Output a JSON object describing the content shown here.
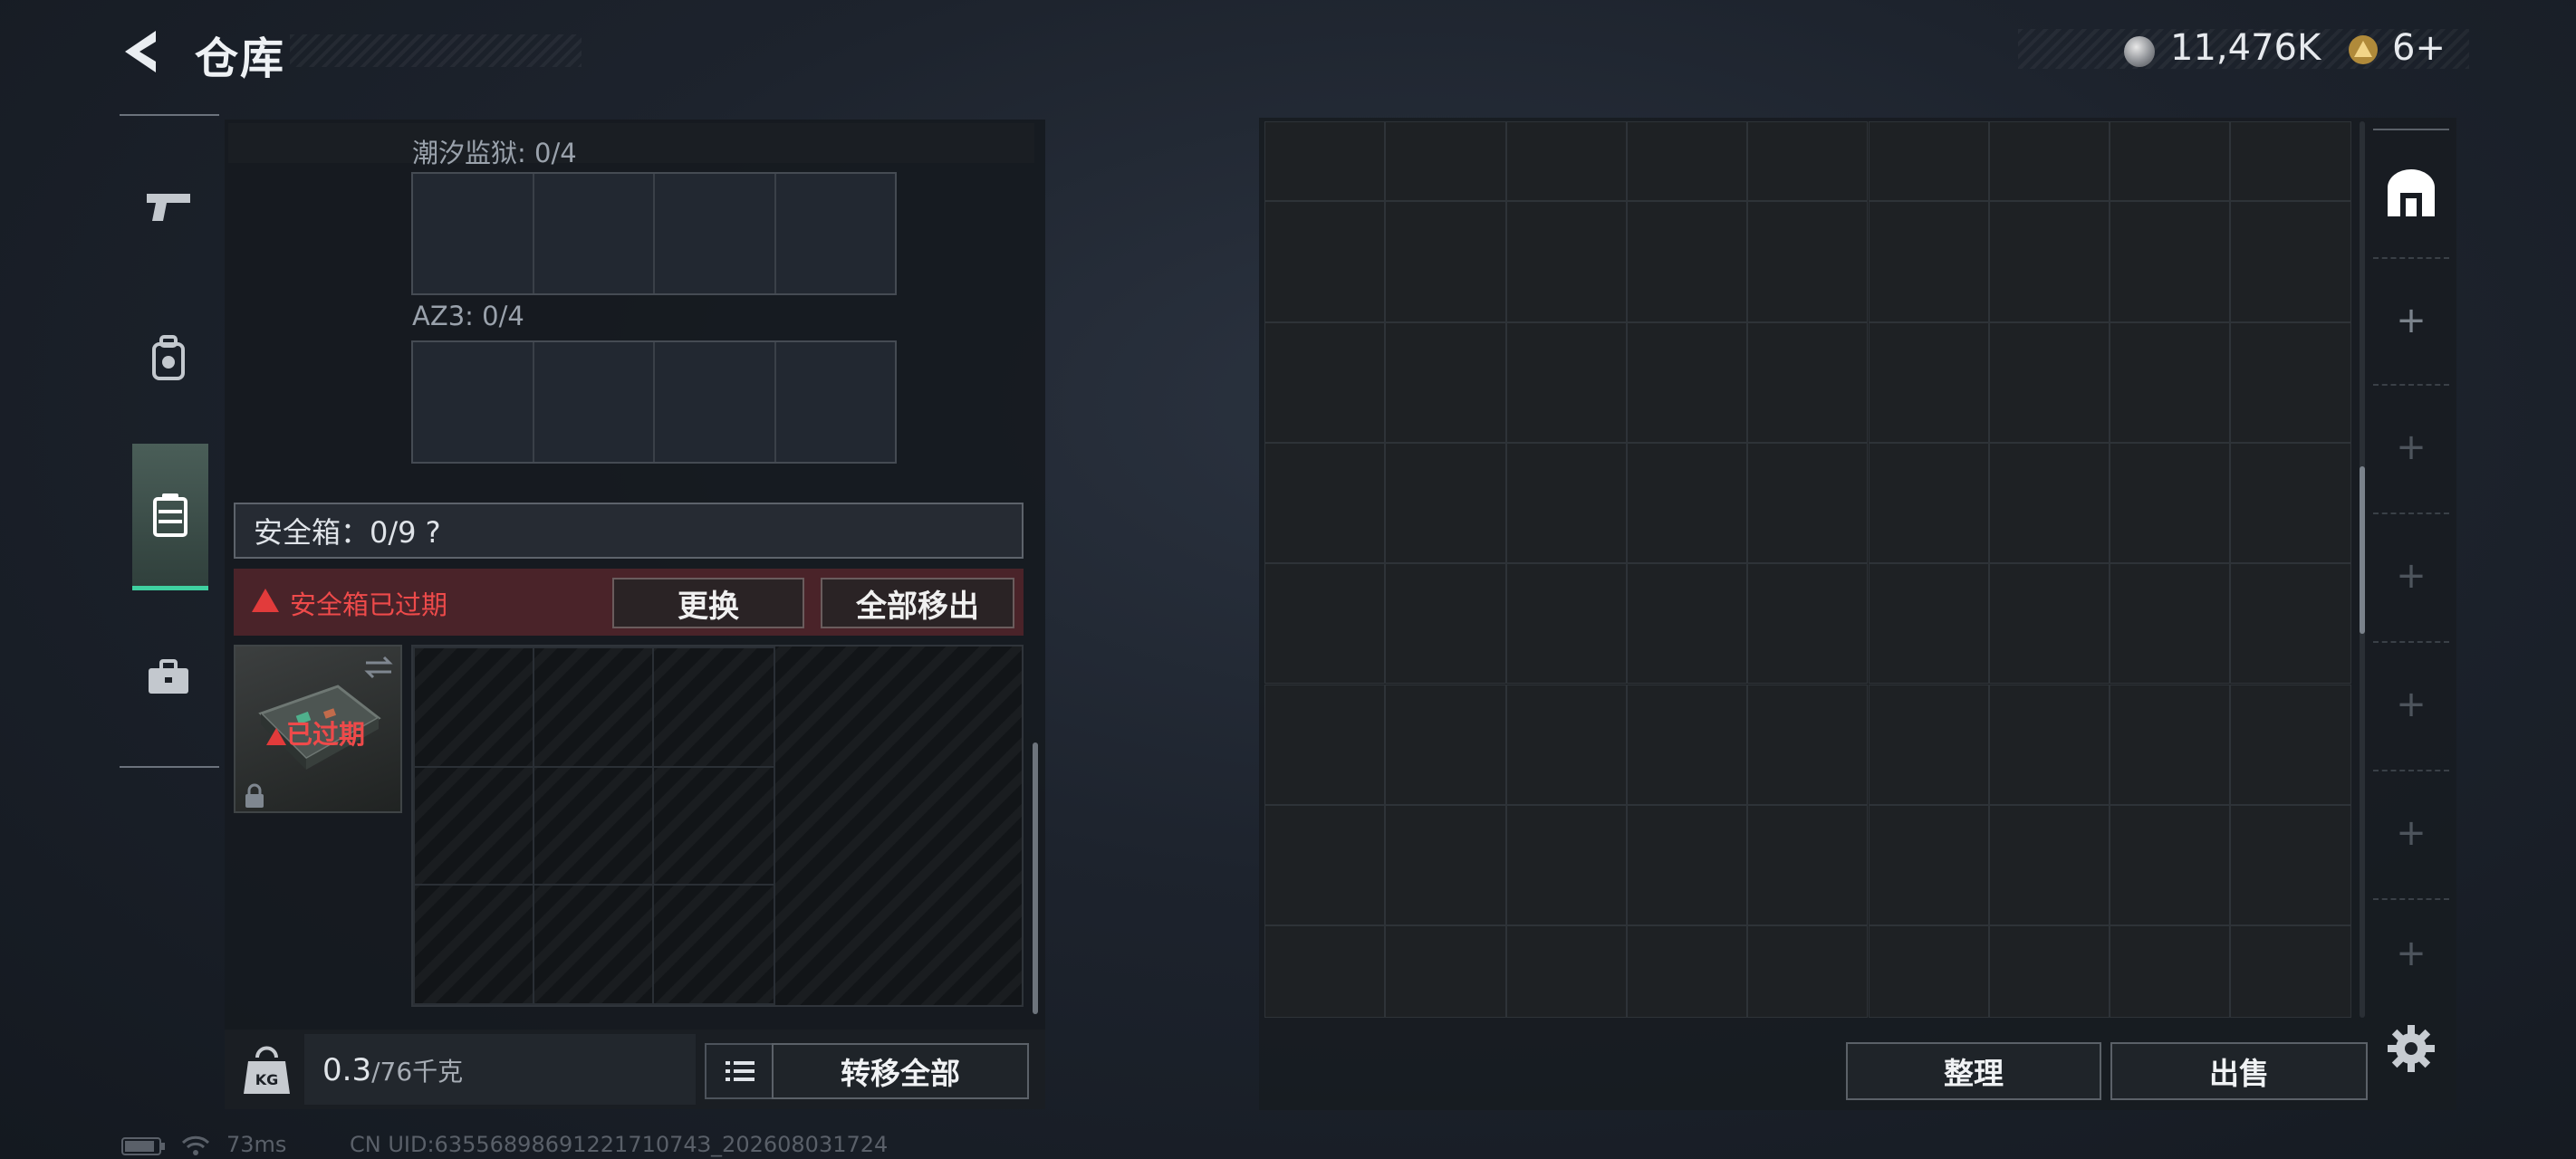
{
  "header": {
    "title": "仓库",
    "currency_main": "11,476K",
    "currency_secondary": "6+"
  },
  "nav": {
    "items": [
      {
        "icon": "pistol-icon"
      },
      {
        "icon": "backpack-icon"
      },
      {
        "icon": "safe-box-icon",
        "active": true
      },
      {
        "icon": "toolbox-icon"
      }
    ]
  },
  "left_panel": {
    "slots": [
      {
        "label": "潮汐监狱: 0/4"
      },
      {
        "label": "AZ3: 0/4"
      }
    ],
    "safe_box": {
      "header": "安全箱：0/9  ?",
      "warning": "安全箱已过期",
      "replace_button": "更换",
      "move_all_button": "全部移出",
      "case_status": "已过期"
    },
    "footer": {
      "weight_value": "0.3",
      "weight_limit": "/76千克",
      "weight_badge": "KG",
      "transfer_all_button": "转移全部"
    }
  },
  "right_panel": {
    "organize_button": "整理",
    "sell_button": "出售",
    "side_tabs": [
      "+",
      "+",
      "+",
      "+",
      "+",
      "+"
    ]
  },
  "status_bar": {
    "ping": "73ms",
    "uid": "CN UID:6355689869122171074З_202608031724"
  },
  "colors": {
    "accent": "#3fd0a0",
    "warning": "#e23b3b",
    "warning_bg": "#4a2329"
  }
}
